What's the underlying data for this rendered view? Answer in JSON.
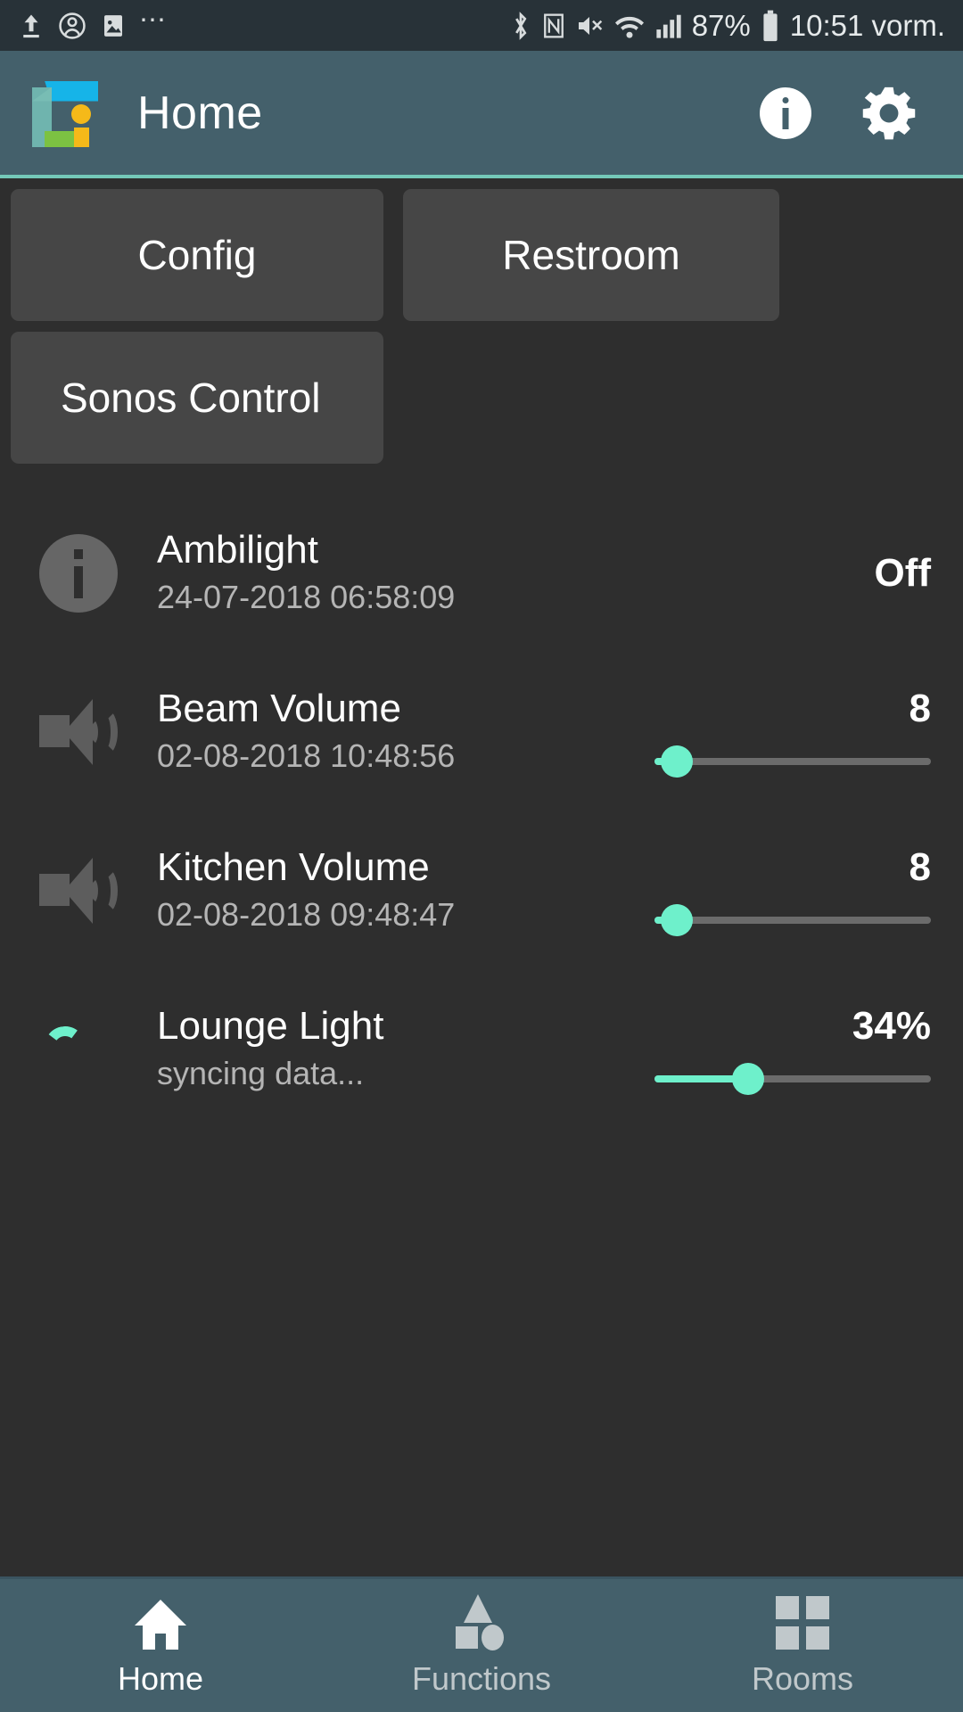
{
  "status_bar": {
    "left_icons": [
      "upload-icon",
      "account-icon",
      "photo-icon",
      "overflow-dots-icon"
    ],
    "right_icons": [
      "bluetooth-icon",
      "nfc-icon",
      "mute-icon",
      "wifi-icon",
      "cellular-signal-icon",
      "battery-icon"
    ],
    "battery_percent": "87%",
    "time": "10:51 vorm."
  },
  "app_bar": {
    "logo": "app-logo",
    "title": "Home",
    "info_label": "i",
    "actions": [
      "info-icon",
      "settings-gear-icon"
    ],
    "accent_color": "#74c8b8",
    "bar_color": "#44606b"
  },
  "quick_buttons": [
    {
      "label": "Config"
    },
    {
      "label": "Restroom"
    },
    {
      "label": "Sonos Control"
    }
  ],
  "devices": [
    {
      "icon": "info-circle-icon",
      "title": "Ambilight",
      "subtitle": "24-07-2018 06:58:09",
      "value": "Off",
      "has_slider": false,
      "slider_percent": 0
    },
    {
      "icon": "speaker-volume-icon",
      "title": "Beam Volume",
      "subtitle": "02-08-2018 10:48:56",
      "value": "8",
      "has_slider": true,
      "slider_percent": 8
    },
    {
      "icon": "speaker-volume-icon",
      "title": "Kitchen Volume",
      "subtitle": "02-08-2018 09:48:47",
      "value": "8",
      "has_slider": true,
      "slider_percent": 8
    },
    {
      "icon": "loading-spinner-icon",
      "title": "Lounge Light",
      "subtitle": "syncing data...",
      "value": "34%",
      "has_slider": true,
      "slider_percent": 34
    }
  ],
  "bottom_nav": [
    {
      "label": "Home",
      "icon": "house-icon",
      "active": true
    },
    {
      "label": "Functions",
      "icon": "shapes-icon",
      "active": false
    },
    {
      "label": "Rooms",
      "icon": "grid-rooms-icon",
      "active": false
    }
  ],
  "colors": {
    "background": "#2e2e2e",
    "card": "#464646",
    "accent_mint": "#6ef0cb",
    "appbar": "#44606b",
    "statusbar": "#283238"
  }
}
